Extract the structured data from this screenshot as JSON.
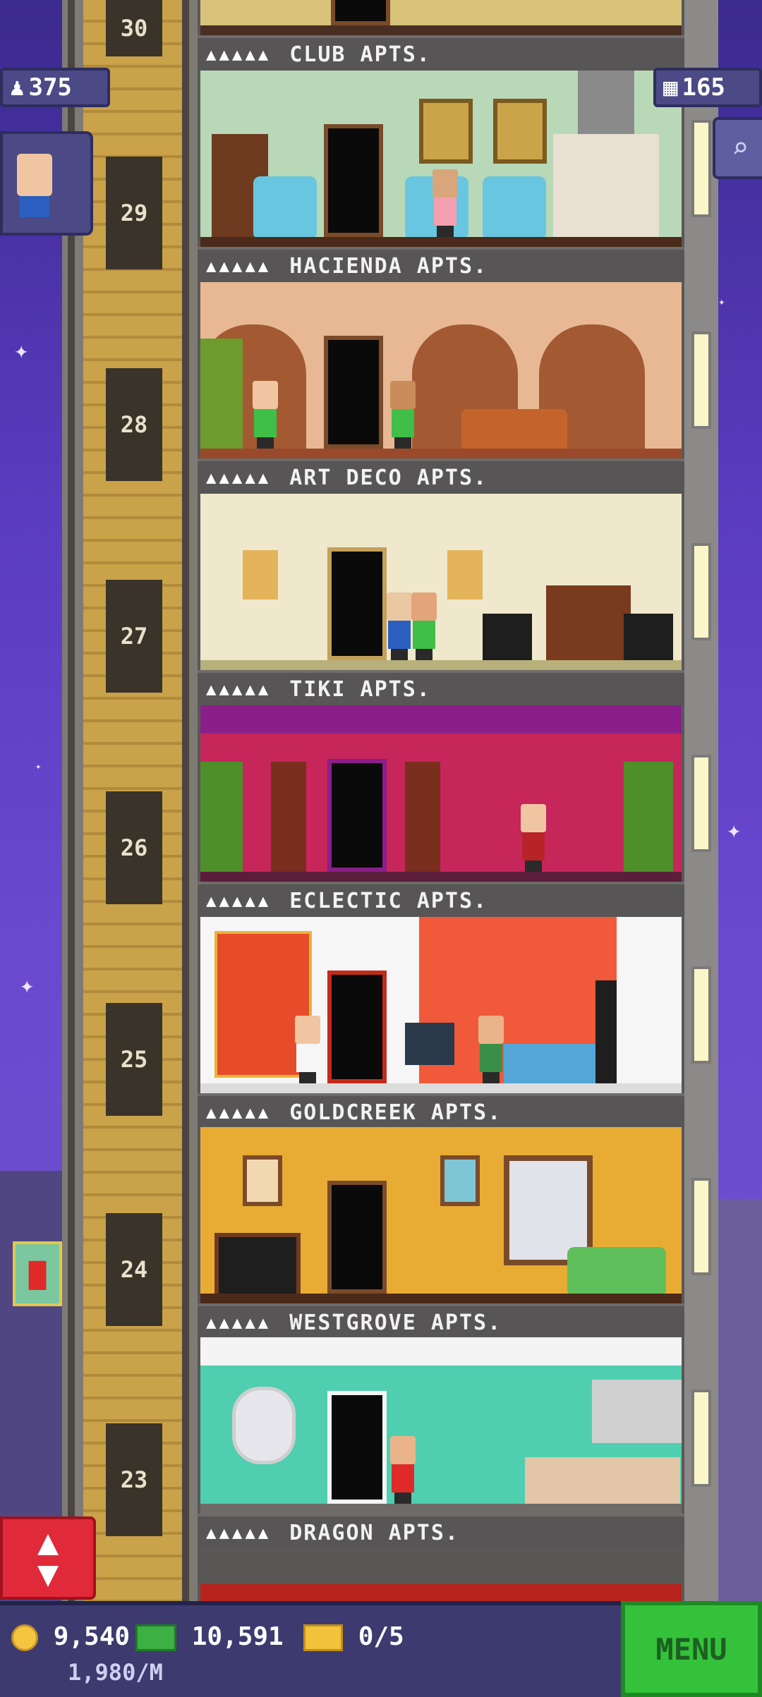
{
  "hud": {
    "population": "375",
    "floors": "165",
    "coins": "9,540",
    "bux": "10,591",
    "tickets": "0/5",
    "income": "1,980/M",
    "menu_label": "MENU"
  },
  "icons": {
    "population": "person-icon",
    "floors": "building-icon",
    "search": "magnifier-icon",
    "elevator": "up-down-arrows-icon",
    "promo": "fries-icon"
  },
  "floors": [
    {
      "number": "29",
      "name": "HACIENDA APTS.",
      "room_above_label": "CLUB APTS.",
      "wall": "#b9d8b8"
    },
    {
      "number": "28",
      "name": "ART DECO APTS.",
      "wall": "#e8b894"
    },
    {
      "number": "27",
      "name": "TIKI APTS.",
      "wall": "#efe8cc"
    },
    {
      "number": "26",
      "name": "ECLECTIC APTS.",
      "wall": "#c6265a"
    },
    {
      "number": "25",
      "name": "GOLDCREEK APTS.",
      "wall": "#f05a3a"
    },
    {
      "number": "24",
      "name": "WESTGROVE APTS.",
      "wall": "#e8ac34"
    },
    {
      "number": "23",
      "name": "DRAGON APTS.",
      "wall": "#4fcfb0"
    }
  ],
  "top_floor": {
    "number": "30",
    "label": "CLUB APTS."
  },
  "people_marks": "▲▲▲▲▲"
}
